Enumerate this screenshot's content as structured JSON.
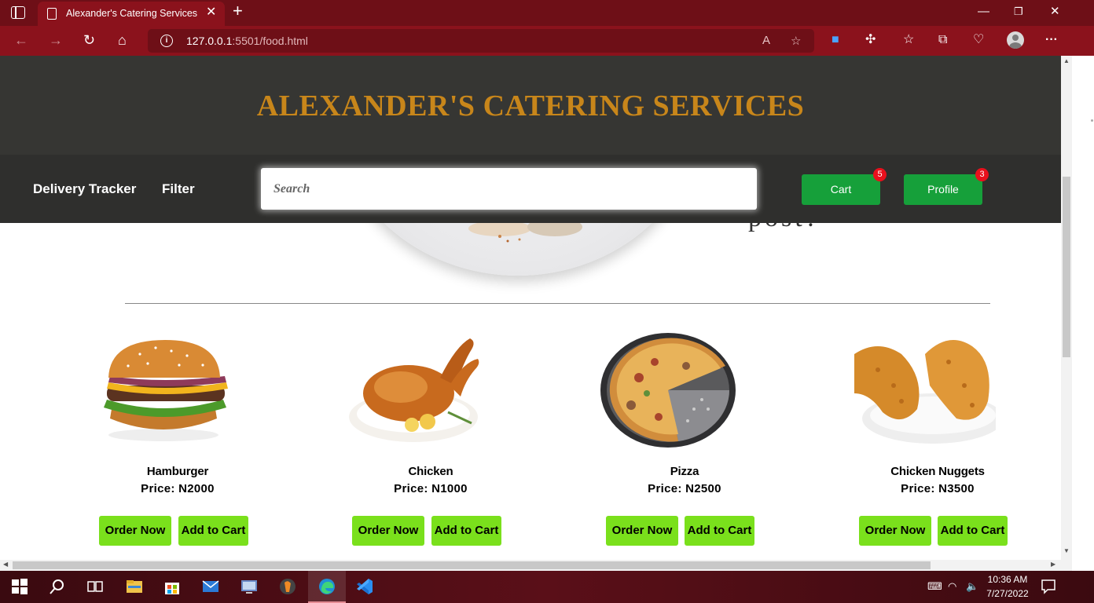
{
  "browser": {
    "tab_title": "Alexander's Catering Services",
    "url_host": "127.0.0.1",
    "url_rest": ":5501/food.html",
    "new_tab_glyph": "+",
    "close_tab_glyph": "✕"
  },
  "site": {
    "title": "ALEXANDER'S CATERING SERVICES",
    "nav": {
      "delivery_tracker": "Delivery Tracker",
      "filter": "Filter",
      "search_placeholder": "Search",
      "cart_label": "Cart",
      "cart_badge": "5",
      "profile_label": "Profile",
      "profile_badge": "3"
    },
    "hero_text": "post?"
  },
  "products": [
    {
      "name": "Hamburger",
      "price": "Price:  N2000",
      "order_label": "Order Now",
      "cart_label": "Add to Cart",
      "image_icon": "hamburger-image"
    },
    {
      "name": "Chicken",
      "price": "Price:  N1000",
      "order_label": "Order Now",
      "cart_label": "Add to Cart",
      "image_icon": "roast-chicken-image"
    },
    {
      "name": "Pizza",
      "price": "Price:  N2500",
      "order_label": "Order Now",
      "cart_label": "Add to Cart",
      "image_icon": "pizza-image"
    },
    {
      "name": "Chicken Nuggets",
      "price": "Price:  N3500",
      "order_label": "Order Now",
      "cart_label": "Add to Cart",
      "image_icon": "fried-chicken-image"
    }
  ],
  "taskbar": {
    "time": "10:36 AM",
    "date": "7/27/2022"
  },
  "colors": {
    "browser_tab_bar": "#6e0f17",
    "browser_toolbar": "#8b121c",
    "header_bg": "#363633",
    "nav_bg": "#2f2f2d",
    "title_gold": "#c8861a",
    "nav_button_green": "#16a03a",
    "badge_red": "#e8101c",
    "product_button_green": "#7ae01c"
  }
}
